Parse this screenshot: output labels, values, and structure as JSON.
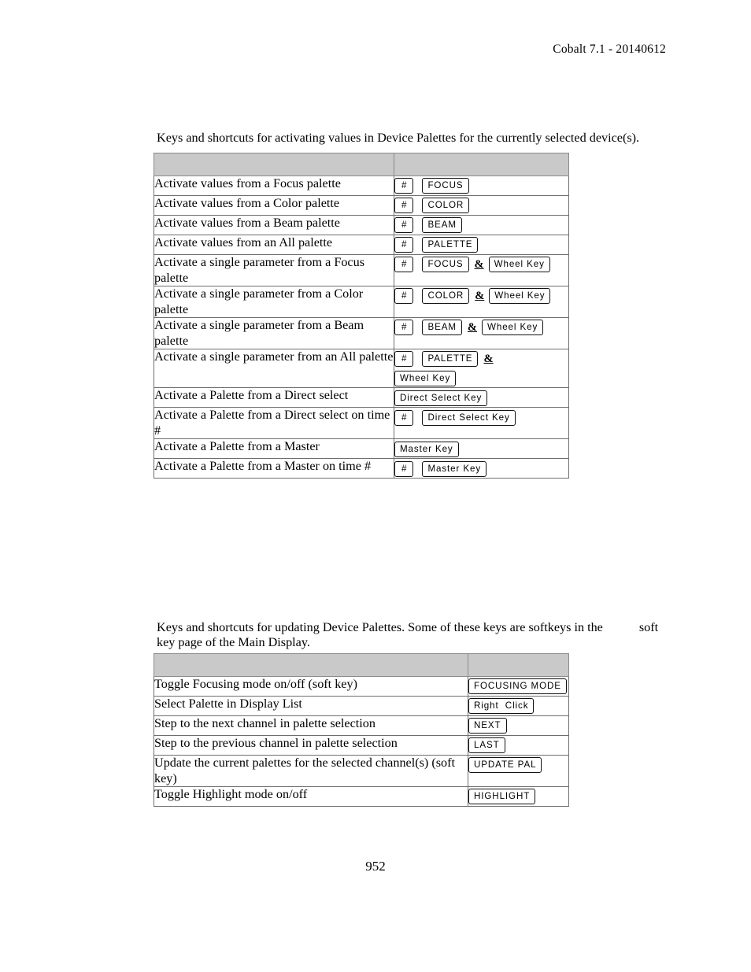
{
  "header": {
    "running_head": "Cobalt 7.1 - 20140612"
  },
  "sections": [
    {
      "intro_before_gap": "Keys and shortcuts for activating values in Device Palettes for the currently selected device(s).",
      "intro_after_gap": "",
      "table": {
        "header_left": "",
        "header_right": "",
        "rows": [
          {
            "desc": "Activate values from a Focus palette",
            "keys": [
              "#",
              "FOCUS"
            ]
          },
          {
            "desc": "Activate values from a Color palette",
            "keys": [
              "#",
              "COLOR"
            ]
          },
          {
            "desc": "Activate values from a Beam palette",
            "keys": [
              "#",
              "BEAM"
            ]
          },
          {
            "desc": "Activate values from an All palette",
            "keys": [
              "#",
              "PALETTE"
            ]
          },
          {
            "desc": "Activate a single parameter from a Focus palette",
            "keys": [
              "#",
              "FOCUS",
              "&",
              "Wheel Key"
            ]
          },
          {
            "desc": "Activate a single parameter from a Color palette",
            "keys": [
              "#",
              "COLOR",
              "&",
              "Wheel Key"
            ]
          },
          {
            "desc": "Activate a single parameter from a Beam palette",
            "keys": [
              "#",
              "BEAM",
              "&",
              "Wheel Key"
            ]
          },
          {
            "desc": "Activate a single parameter from an All palette",
            "keys": [
              "#",
              "PALETTE",
              "&",
              "Wheel Key"
            ]
          },
          {
            "desc": "Activate a Palette from a Direct select",
            "keys": [
              "Direct Select Key"
            ]
          },
          {
            "desc": "Activate a Palette from a Direct select on time #",
            "keys": [
              "#",
              "Direct Select Key"
            ]
          },
          {
            "desc": "Activate a Palette from a Master",
            "keys": [
              "Master Key"
            ]
          },
          {
            "desc": "Activate a Palette from a Master on time #",
            "keys": [
              "#",
              "Master Key"
            ]
          }
        ]
      }
    },
    {
      "intro_before_gap": "Keys and shortcuts for updating Device Palettes. Some of these keys are softkeys in the",
      "intro_after_gap": "soft key page of the Main Display.",
      "table": {
        "header_left": "",
        "header_right": "",
        "rows": [
          {
            "desc": "Toggle Focusing mode on/off (soft key)",
            "keys": [
              "FOCUSING MODE"
            ]
          },
          {
            "desc": "Select Palette in Display List",
            "keys": [
              "Right  Click"
            ]
          },
          {
            "desc": "Step to the next channel in palette selection",
            "keys": [
              "NEXT"
            ]
          },
          {
            "desc": "Step to the previous channel in palette selection",
            "keys": [
              "LAST"
            ]
          },
          {
            "desc": "Update the current palettes for the selected channel(s) (soft key)",
            "keys": [
              "UPDATE PAL"
            ]
          },
          {
            "desc": "Toggle Highlight mode on/off",
            "keys": [
              "HIGHLIGHT"
            ]
          }
        ]
      }
    }
  ],
  "footer": {
    "page_number": "952"
  },
  "colors": {
    "header_fill": "#c9c9c9",
    "table_border": "#6e6e6e",
    "outer_border": "#808080",
    "text": "#000000",
    "key_border": "#111111"
  }
}
